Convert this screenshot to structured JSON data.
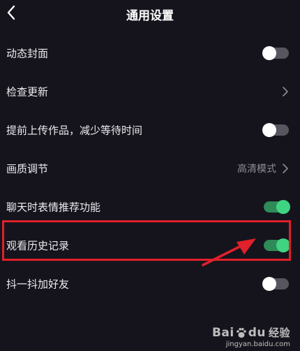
{
  "header": {
    "title": "通用设置"
  },
  "settings": [
    {
      "label": "动态封面",
      "control": "toggle",
      "on": false
    },
    {
      "label": "检查更新",
      "control": "chevron",
      "value": ""
    },
    {
      "label": "提前上传作品，减少等待时间",
      "control": "toggle",
      "on": false
    },
    {
      "label": "画质调节",
      "control": "chevron",
      "value": "高清模式"
    },
    {
      "label": "聊天时表情推荐功能",
      "control": "toggle",
      "on": true
    },
    {
      "label": "观看历史记录",
      "control": "toggle",
      "on": true
    },
    {
      "label": "抖一抖加好友",
      "control": "toggle",
      "on": false
    }
  ],
  "colors": {
    "background": "#15141c",
    "toggle_on_track": "#2e8a58",
    "toggle_on_knob": "#3fd481",
    "toggle_off_track": "#57565e",
    "annotation_red": "#e0202a"
  },
  "watermark": {
    "brand_left": "Bai",
    "brand_right": "du",
    "brand_cn": "经验",
    "url": "jingyan.baidu.com"
  },
  "icons": {
    "back": "chevron-left-icon",
    "forward": "chevron-right-icon",
    "watermark": "baidu-paw-icon"
  }
}
